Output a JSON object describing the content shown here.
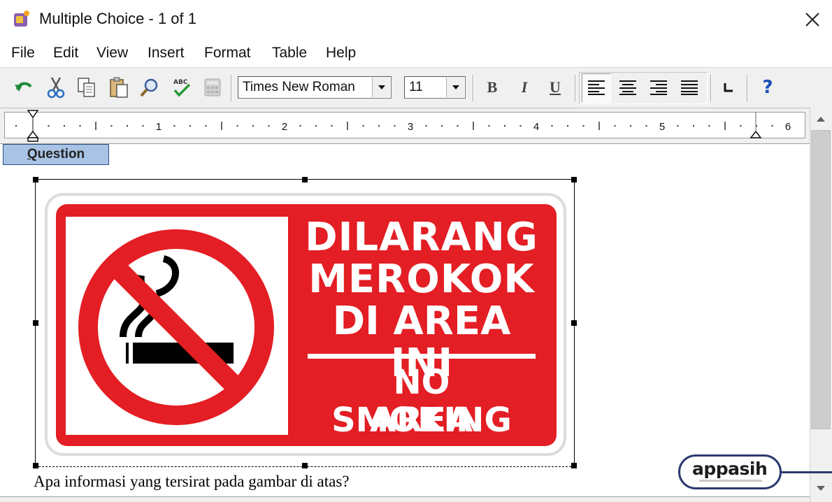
{
  "window": {
    "title": "Multiple Choice - 1 of 1"
  },
  "menu": {
    "items": [
      "File",
      "Edit",
      "View",
      "Insert",
      "Format",
      "Table",
      "Help"
    ]
  },
  "toolbar": {
    "font_name": "Times New Roman",
    "font_size": "11",
    "bold_label": "B",
    "italic_label": "I",
    "underline_label": "U",
    "spell_label": "ABC",
    "help_label": "?"
  },
  "ruler": {
    "marks": [
      "1",
      "2",
      "3",
      "4",
      "5",
      "6"
    ]
  },
  "question_tab": {
    "label_first": "Q",
    "label_rest": "uestion"
  },
  "sign": {
    "line1": "DILARANG",
    "line2": "MEROKOK",
    "line3": "DI AREA INI",
    "line4": "NO SMOKING",
    "line5": "AREA",
    "colors": {
      "red": "#e31e24",
      "white": "#ffffff",
      "black": "#000000"
    }
  },
  "question": {
    "text": "Apa informasi yang tersirat pada gambar di atas?"
  },
  "watermark": {
    "text": "appasih"
  }
}
